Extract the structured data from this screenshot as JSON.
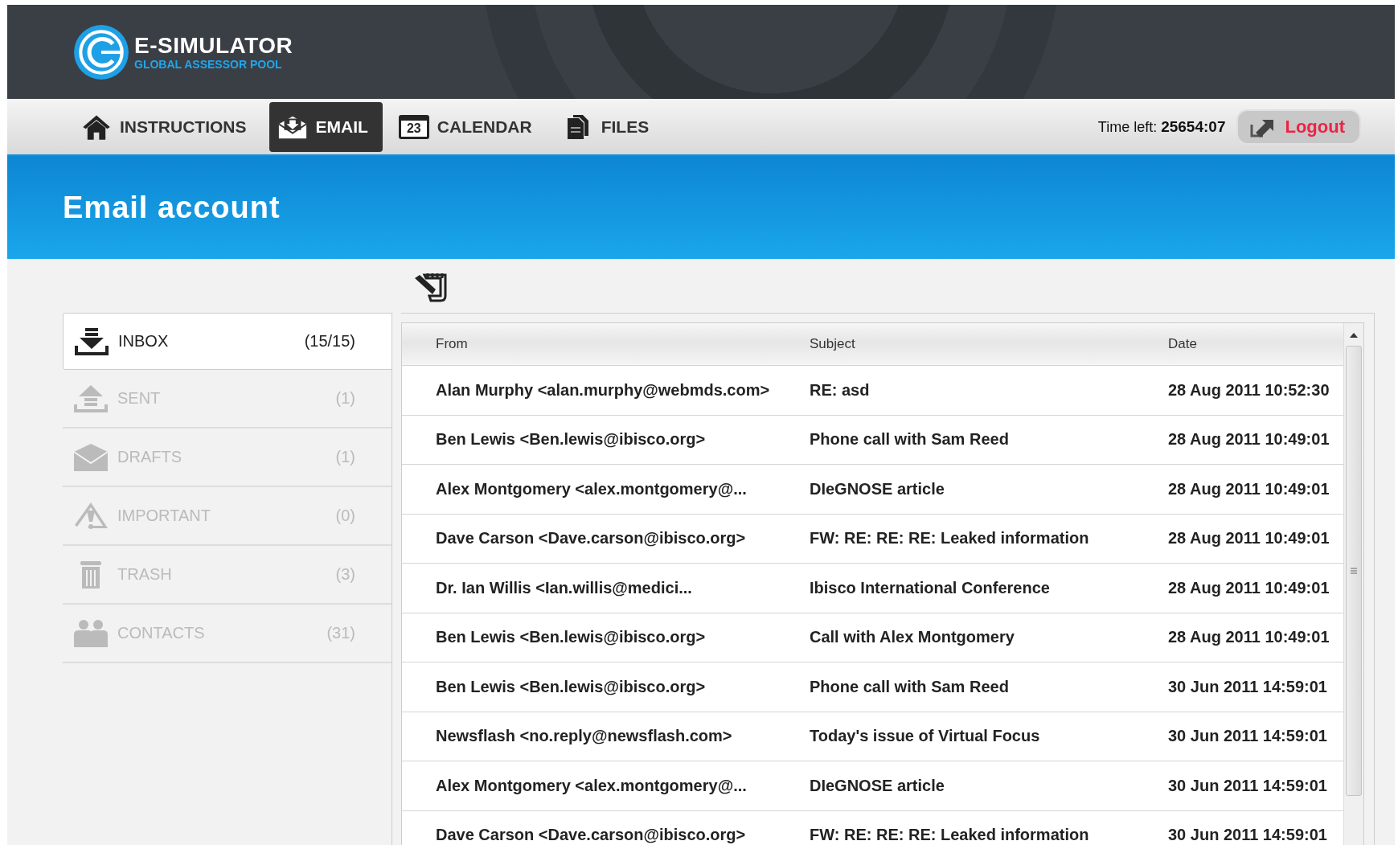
{
  "logo": {
    "title": "E-SIMULATOR",
    "subtitle": "GLOBAL ASSESSOR POOL"
  },
  "nav": [
    {
      "kind": "home",
      "label": "INSTRUCTIONS",
      "selected": false
    },
    {
      "kind": "email",
      "label": "EMAIL",
      "selected": true
    },
    {
      "kind": "calendar",
      "label": "CALENDAR",
      "icon_text": "23",
      "selected": false
    },
    {
      "kind": "files",
      "label": "FILES",
      "selected": false
    }
  ],
  "timer": {
    "label": "Time left:",
    "value": "25654:07"
  },
  "logout": {
    "label": "Logout"
  },
  "banner": {
    "title": "Email account"
  },
  "folders": [
    {
      "kind": "inbox",
      "label": "INBOX",
      "count": "(15/15)",
      "selected": true
    },
    {
      "kind": "sent",
      "label": "SENT",
      "count": "(1)",
      "selected": false
    },
    {
      "kind": "drafts",
      "label": "DRAFTS",
      "count": "(1)",
      "selected": false
    },
    {
      "kind": "important",
      "label": "IMPORTANT",
      "count": "(0)",
      "selected": false
    },
    {
      "kind": "trash",
      "label": "TRASH",
      "count": "(3)",
      "selected": false
    },
    {
      "kind": "contacts",
      "label": "CONTACTS",
      "count": "(31)",
      "selected": false
    }
  ],
  "table": {
    "columns": [
      "From",
      "Subject",
      "Date"
    ],
    "rows": [
      {
        "from": "Alan Murphy <alan.murphy@webmds.com>",
        "subject": "RE: asd",
        "date": "28 Aug 2011 10:52:30"
      },
      {
        "from": "Ben Lewis <Ben.lewis@ibisco.org>",
        "subject": "Phone call with Sam Reed",
        "date": "28 Aug 2011 10:49:01"
      },
      {
        "from": "Alex Montgomery <alex.montgomery@...",
        "subject": "DIeGNOSE article",
        "date": "28 Aug 2011 10:49:01"
      },
      {
        "from": "Dave Carson <Dave.carson@ibisco.org>",
        "subject": "FW: RE: RE: RE: Leaked information",
        "date": "28 Aug 2011 10:49:01"
      },
      {
        "from": "Dr. Ian Willis <Ian.willis@medici...",
        "subject": "Ibisco International Conference",
        "date": "28 Aug 2011 10:49:01"
      },
      {
        "from": "Ben Lewis <Ben.lewis@ibisco.org>",
        "subject": "Call with Alex Montgomery",
        "date": "28 Aug 2011 10:49:01"
      },
      {
        "from": "Ben Lewis <Ben.lewis@ibisco.org>",
        "subject": "Phone call with Sam Reed",
        "date": "30 Jun 2011 14:59:01"
      },
      {
        "from": "Newsflash <no.reply@newsflash.com>",
        "subject": "Today's issue of Virtual Focus",
        "date": "30 Jun 2011 14:59:01"
      },
      {
        "from": "Alex Montgomery <alex.montgomery@...",
        "subject": "DIeGNOSE article",
        "date": "30 Jun 2011 14:59:01"
      },
      {
        "from": "Dave Carson <Dave.carson@ibisco.org>",
        "subject": "FW: RE: RE: RE: Leaked information",
        "date": "30 Jun 2011 14:59:01"
      }
    ]
  }
}
